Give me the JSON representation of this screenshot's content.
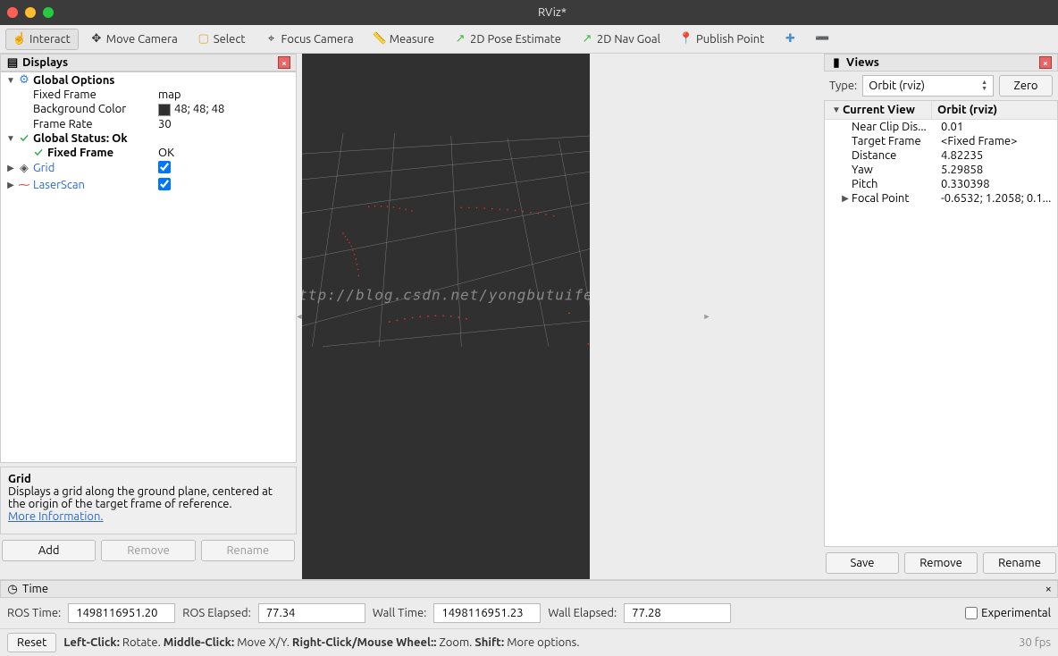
{
  "window": {
    "title": "RViz*"
  },
  "toolbar": {
    "interact": "Interact",
    "move_camera": "Move Camera",
    "select": "Select",
    "focus_camera": "Focus Camera",
    "measure": "Measure",
    "pose_estimate": "2D Pose Estimate",
    "nav_goal": "2D Nav Goal",
    "publish_point": "Publish Point"
  },
  "displays": {
    "title": "Displays",
    "global_options": "Global Options",
    "fixed_frame_label": "Fixed Frame",
    "fixed_frame_value": "map",
    "bg_color_label": "Background Color",
    "bg_color_value": "48; 48; 48",
    "frame_rate_label": "Frame Rate",
    "frame_rate_value": "30",
    "global_status": "Global Status: Ok",
    "ff_status_label": "Fixed Frame",
    "ff_status_value": "OK",
    "grid_label": "Grid",
    "laserscan_label": "LaserScan",
    "desc_title": "Grid",
    "desc_body": "Displays a grid along the ground plane, centered at the origin of the target frame of reference.",
    "desc_link": "More Information",
    "add": "Add",
    "remove": "Remove",
    "rename": "Rename"
  },
  "views": {
    "title": "Views",
    "type_label": "Type:",
    "type_value": "Orbit (rviz)",
    "zero": "Zero",
    "col_prop": "Current View",
    "col_val": "Orbit (rviz)",
    "near_clip_k": "Near Clip Dis...",
    "near_clip_v": "0.01",
    "target_frame_k": "Target Frame",
    "target_frame_v": "<Fixed Frame>",
    "distance_k": "Distance",
    "distance_v": "4.82235",
    "yaw_k": "Yaw",
    "yaw_v": "5.29858",
    "pitch_k": "Pitch",
    "pitch_v": "0.330398",
    "focal_k": "Focal Point",
    "focal_v": "-0.6532; 1.2058; 0.1...",
    "save": "Save",
    "remove": "Remove",
    "rename": "Rename"
  },
  "time": {
    "title": "Time",
    "ros_time_l": "ROS Time:",
    "ros_time_v": "1498116951.20",
    "ros_elapsed_l": "ROS Elapsed:",
    "ros_elapsed_v": "77.34",
    "wall_time_l": "Wall Time:",
    "wall_time_v": "1498116951.23",
    "wall_elapsed_l": "Wall Elapsed:",
    "wall_elapsed_v": "77.28",
    "experimental": "Experimental"
  },
  "footer": {
    "reset": "Reset",
    "hints": "Left-Click: Rotate. Middle-Click: Move X/Y. Right-Click/Mouse Wheel:: Zoom. Shift: More options.",
    "fps": "30 fps"
  },
  "watermark": "http://blog.csdn.net/yongbutuifei"
}
